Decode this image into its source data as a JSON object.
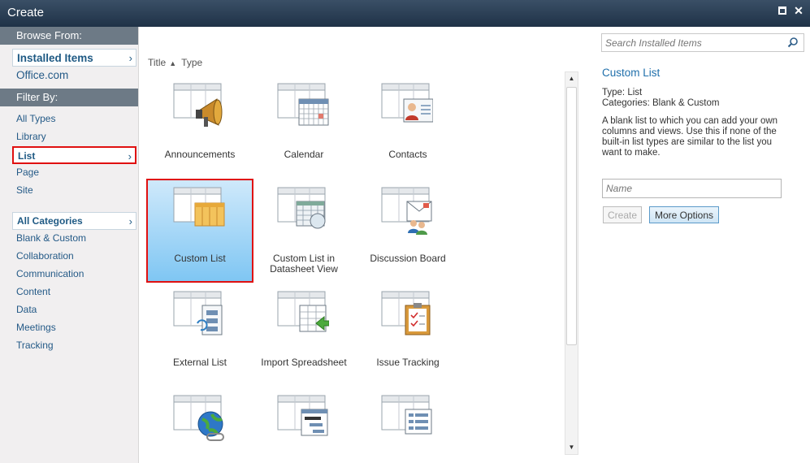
{
  "window": {
    "title": "Create",
    "maximize_icon": "maximize-icon",
    "close_icon": "close-icon"
  },
  "leftnav": {
    "browse_heading": "Browse From:",
    "browse_items": [
      {
        "label": "Installed Items",
        "selected": true
      },
      {
        "label": "Office.com",
        "selected": false
      }
    ],
    "filter_heading": "Filter By:",
    "type_items": [
      {
        "label": "All Types",
        "selected": false
      },
      {
        "label": "Library",
        "selected": false
      },
      {
        "label": "List",
        "selected": true
      },
      {
        "label": "Page",
        "selected": false
      },
      {
        "label": "Site",
        "selected": false
      }
    ],
    "category_items": [
      {
        "label": "All Categories",
        "selected": true
      },
      {
        "label": "Blank & Custom",
        "selected": false
      },
      {
        "label": "Collaboration",
        "selected": false
      },
      {
        "label": "Communication",
        "selected": false
      },
      {
        "label": "Content",
        "selected": false
      },
      {
        "label": "Data",
        "selected": false
      },
      {
        "label": "Meetings",
        "selected": false
      },
      {
        "label": "Tracking",
        "selected": false
      }
    ]
  },
  "sort": {
    "title_label": "Title",
    "type_label": "Type"
  },
  "tiles": [
    {
      "label": "Announcements",
      "icon": "announcements-icon"
    },
    {
      "label": "Calendar",
      "icon": "calendar-icon"
    },
    {
      "label": "Contacts",
      "icon": "contacts-icon"
    },
    {
      "label": "Custom List",
      "icon": "custom-list-icon",
      "selected": true
    },
    {
      "label": "Custom List in Datasheet View",
      "icon": "datasheet-icon"
    },
    {
      "label": "Discussion Board",
      "icon": "discussion-board-icon"
    },
    {
      "label": "External List",
      "icon": "external-list-icon"
    },
    {
      "label": "Import Spreadsheet",
      "icon": "import-spreadsheet-icon"
    },
    {
      "label": "Issue Tracking",
      "icon": "issue-tracking-icon"
    },
    {
      "label": "",
      "icon": "links-icon"
    },
    {
      "label": "",
      "icon": "project-tasks-icon"
    },
    {
      "label": "",
      "icon": "survey-icon"
    }
  ],
  "right_panel": {
    "search_placeholder": "Search Installed Items",
    "title": "Custom List",
    "type_line": "Type: List",
    "categories_line": "Categories: Blank & Custom",
    "description": "A blank list to which you can add your own columns and views. Use this if none of the built-in list types are similar to the list you want to make.",
    "name_placeholder": "Name",
    "create_label": "Create",
    "more_options_label": "More Options"
  }
}
